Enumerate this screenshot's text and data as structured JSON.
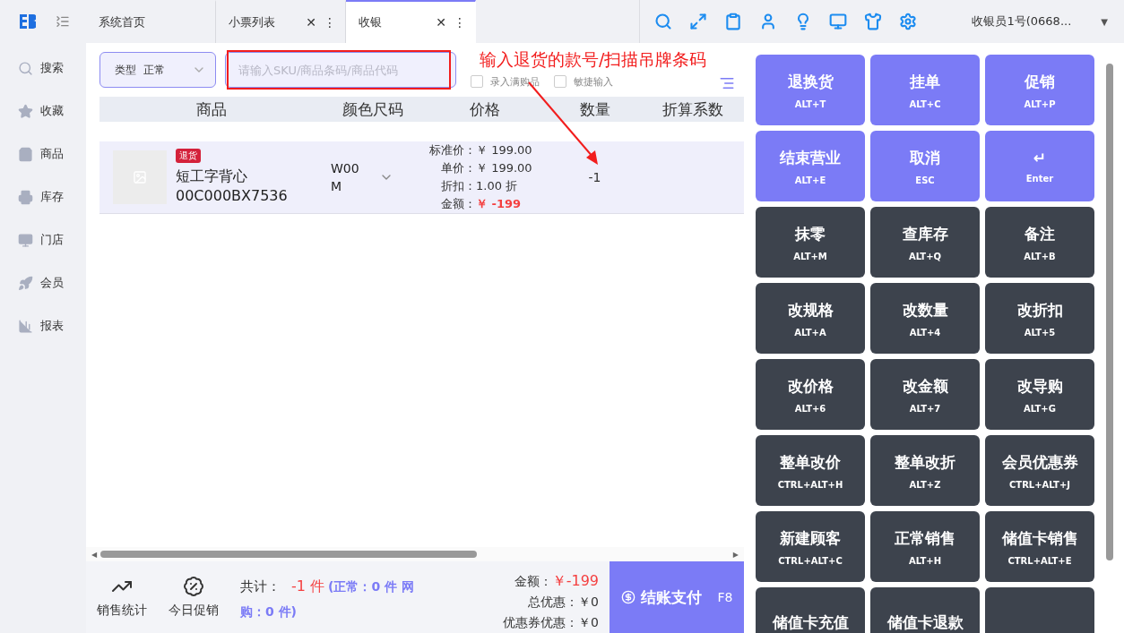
{
  "topbar": {
    "tabs": [
      {
        "label": "系统首页",
        "selected": false,
        "closable": false
      },
      {
        "label": "小票列表",
        "selected": false,
        "closable": true
      },
      {
        "label": "收银",
        "selected": true,
        "closable": true
      }
    ],
    "close_mark": "✕",
    "more_mark": "⋮",
    "user": "收银员1号(0668...",
    "user_caret": "▼"
  },
  "sidebar": {
    "items": [
      {
        "label": "搜索"
      },
      {
        "label": "收藏"
      },
      {
        "label": "商品"
      },
      {
        "label": "库存"
      },
      {
        "label": "门店"
      },
      {
        "label": "会员"
      },
      {
        "label": "报表"
      }
    ]
  },
  "scrollbar": {
    "left": "◀",
    "right": "▶"
  },
  "toolbar": {
    "type_label": "类型",
    "type_value": "正常",
    "search": {
      "placeholder": "请输入SKU/商品条码/商品代码"
    },
    "checks": [
      {
        "label": "录入满购品",
        "checked": false
      },
      {
        "label": "敏捷输入",
        "checked": false
      }
    ]
  },
  "annotation": {
    "text": "输入退货的款号/扫描吊牌条码"
  },
  "table": {
    "columns": [
      "商品",
      "颜色尺码",
      "价格",
      "数量",
      "折算系数"
    ],
    "rows": [
      {
        "badge": "退货",
        "name": "短工字背心",
        "code": "00C000BX7536",
        "spec": "W00\nM",
        "prices": [
          {
            "label": "标准价：",
            "value": "￥ 199.00",
            "kind": "plain"
          },
          {
            "label": "单价：",
            "value": "￥ 199.00",
            "kind": "plain"
          },
          {
            "label": "折扣：",
            "value": "1.00 折",
            "kind": "plain"
          },
          {
            "label": "金额：",
            "value": "￥ -199",
            "kind": "total"
          }
        ],
        "qty": "-1"
      }
    ]
  },
  "footer": {
    "actions": [
      {
        "label": "销售统计"
      },
      {
        "label": "今日促销"
      }
    ],
    "total_label": "共计：",
    "total_value": "-1 件",
    "total_detail": "(正常：0 件  网购：0 件)",
    "sums": [
      {
        "label": "金额：",
        "value": "￥-199",
        "kind": "highlight"
      },
      {
        "label": "总优惠：",
        "value": "￥0",
        "kind": "plain"
      },
      {
        "label": "优惠券优惠：",
        "value": "￥0",
        "kind": "plain"
      }
    ],
    "pay": {
      "label": "结账支付",
      "key": "F8"
    }
  },
  "keys": [
    {
      "label": "退换货",
      "key": "ALT+T",
      "kind": "primary"
    },
    {
      "label": "挂单",
      "key": "ALT+C",
      "kind": "primary"
    },
    {
      "label": "促销",
      "key": "ALT+P",
      "kind": "primary"
    },
    {
      "label": "结束营业",
      "key": "ALT+E",
      "kind": "primary"
    },
    {
      "label": "取消",
      "key": "ESC",
      "kind": "primary"
    },
    {
      "label": "↵",
      "key": "Enter",
      "kind": "primary"
    },
    {
      "label": "抹零",
      "key": "ALT+M",
      "kind": "dark"
    },
    {
      "label": "查库存",
      "key": "ALT+Q",
      "kind": "dark"
    },
    {
      "label": "备注",
      "key": "ALT+B",
      "kind": "dark"
    },
    {
      "label": "改规格",
      "key": "ALT+A",
      "kind": "dark"
    },
    {
      "label": "改数量",
      "key": "ALT+4",
      "kind": "dark"
    },
    {
      "label": "改折扣",
      "key": "ALT+5",
      "kind": "dark"
    },
    {
      "label": "改价格",
      "key": "ALT+6",
      "kind": "dark"
    },
    {
      "label": "改金额",
      "key": "ALT+7",
      "kind": "dark"
    },
    {
      "label": "改导购",
      "key": "ALT+G",
      "kind": "dark"
    },
    {
      "label": "整单改价",
      "key": "CTRL+ALT+H",
      "kind": "dark"
    },
    {
      "label": "整单改折",
      "key": "ALT+Z",
      "kind": "dark"
    },
    {
      "label": "会员优惠券",
      "key": "CTRL+ALT+J",
      "kind": "dark"
    },
    {
      "label": "新建顾客",
      "key": "CTRL+ALT+C",
      "kind": "dark"
    },
    {
      "label": "正常销售",
      "key": "ALT+H",
      "kind": "dark"
    },
    {
      "label": "储值卡销售",
      "key": "CTRL+ALT+E",
      "kind": "dark"
    },
    {
      "label": "储值卡充值",
      "kind": "dark"
    },
    {
      "label": "储值卡退款",
      "kind": "dark"
    },
    {
      "kind": "dark"
    }
  ]
}
